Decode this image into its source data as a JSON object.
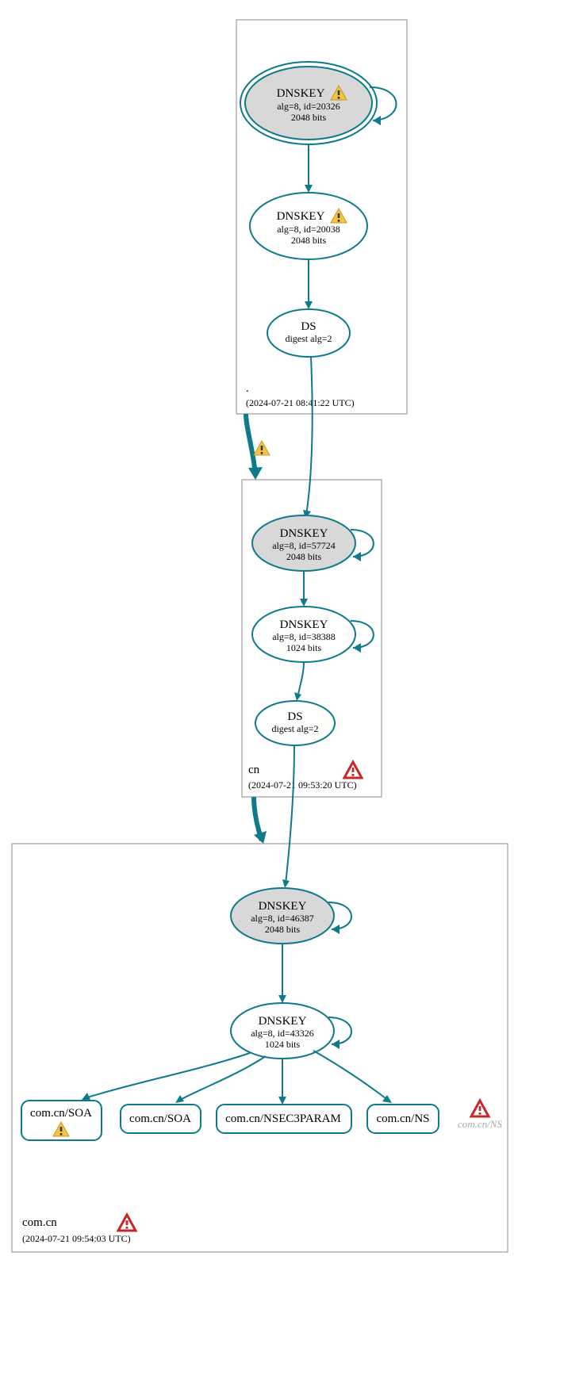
{
  "zones": {
    "root": {
      "label": ".",
      "timestamp": "(2024-07-21 08:41:22 UTC)"
    },
    "cn": {
      "label": "cn",
      "timestamp": "(2024-07-21 09:53:20 UTC)"
    },
    "comcn": {
      "label": "com.cn",
      "timestamp": "(2024-07-21 09:54:03 UTC)"
    }
  },
  "nodes": {
    "root_ksk": {
      "title": "DNSKEY",
      "line2": "alg=8, id=20326",
      "line3": "2048 bits"
    },
    "root_zsk": {
      "title": "DNSKEY",
      "line2": "alg=8, id=20038",
      "line3": "2048 bits"
    },
    "root_ds": {
      "title": "DS",
      "line2": "digest alg=2"
    },
    "cn_ksk": {
      "title": "DNSKEY",
      "line2": "alg=8, id=57724",
      "line3": "2048 bits"
    },
    "cn_zsk": {
      "title": "DNSKEY",
      "line2": "alg=8, id=38388",
      "line3": "1024 bits"
    },
    "cn_ds": {
      "title": "DS",
      "line2": "digest alg=2"
    },
    "comcn_ksk": {
      "title": "DNSKEY",
      "line2": "alg=8, id=46387",
      "line3": "2048 bits"
    },
    "comcn_zsk": {
      "title": "DNSKEY",
      "line2": "alg=8, id=43326",
      "line3": "1024 bits"
    },
    "rr_soa1": {
      "label": "com.cn/SOA"
    },
    "rr_soa2": {
      "label": "com.cn/SOA"
    },
    "rr_nsec3": {
      "label": "com.cn/NSEC3PARAM"
    },
    "rr_ns": {
      "label": "com.cn/NS"
    },
    "faded_ns": {
      "label": "com.cn/NS"
    }
  }
}
